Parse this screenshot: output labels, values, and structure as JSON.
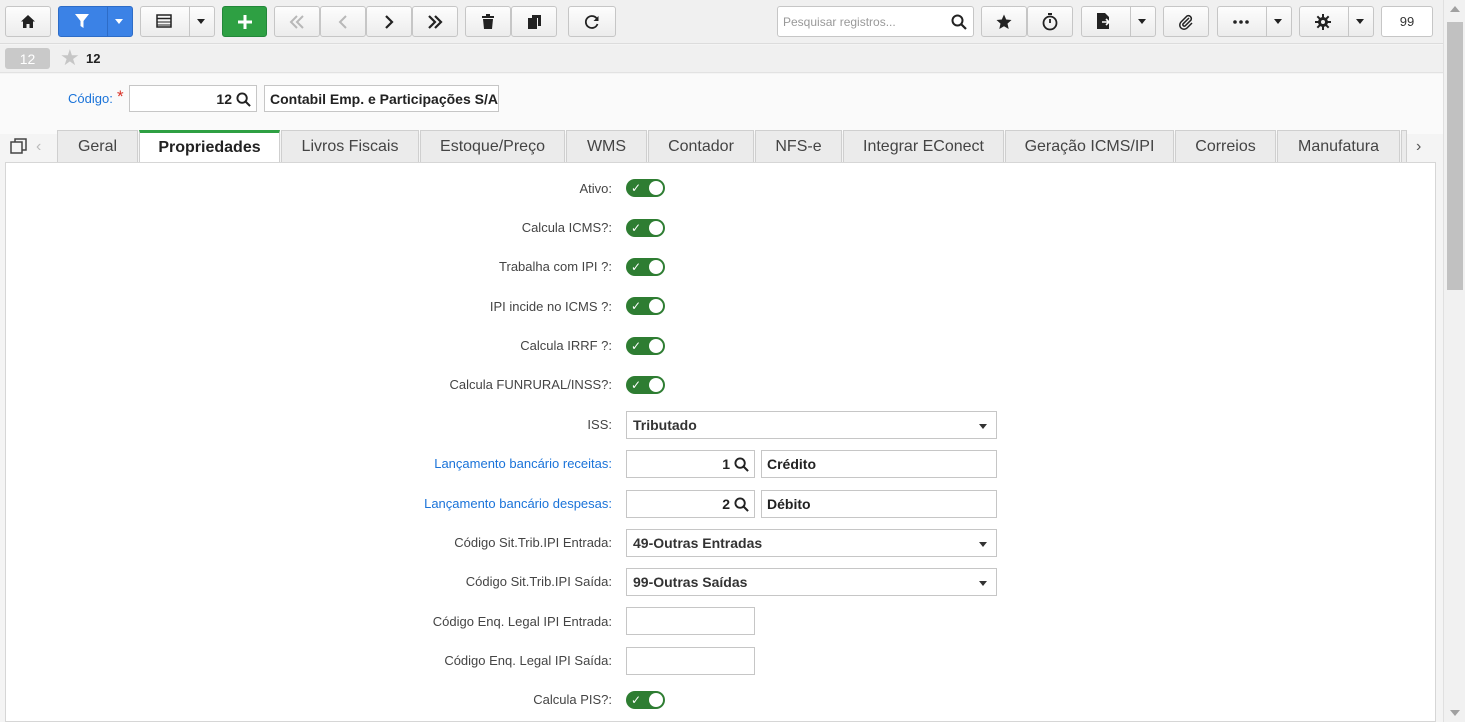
{
  "toolbar": {
    "search_placeholder": "Pesquisar registros...",
    "counter": "99",
    "icons": [
      "home-icon",
      "filter-icon",
      "table-icon",
      "add-icon",
      "first-icon",
      "prev-icon",
      "next-icon",
      "last-icon",
      "trash-icon",
      "copy-icon",
      "refresh-icon",
      "search-icon",
      "star-icon",
      "timer-icon",
      "export-icon",
      "attach-icon",
      "more-icon",
      "gear-icon"
    ],
    "colors": {
      "filter": "#3b82e6",
      "add": "#2ea043"
    }
  },
  "record": {
    "badge": "12",
    "number": "12"
  },
  "header": {
    "codigo_label": "Código:",
    "required_mark": "*",
    "codigo_value": "12",
    "name_value": "Contabil Emp. e Participações S/A"
  },
  "tabs": [
    {
      "label": "Geral",
      "active": false
    },
    {
      "label": "Propriedades",
      "active": true
    },
    {
      "label": "Livros Fiscais",
      "active": false
    },
    {
      "label": "Estoque/Preço",
      "active": false
    },
    {
      "label": "WMS",
      "active": false
    },
    {
      "label": "Contador",
      "active": false
    },
    {
      "label": "NFS-e",
      "active": false
    },
    {
      "label": "Integrar EConect",
      "active": false
    },
    {
      "label": "Geração ICMS/IPI",
      "active": false
    },
    {
      "label": "Correios",
      "active": false
    },
    {
      "label": "Manufatura",
      "active": false
    }
  ],
  "form": {
    "ativo": {
      "label": "Ativo:",
      "value": true
    },
    "calcula_icms": {
      "label": "Calcula ICMS?:",
      "value": true
    },
    "trabalha_ipi": {
      "label": "Trabalha com IPI ?:",
      "value": true
    },
    "ipi_incide": {
      "label": "IPI incide no ICMS ?:",
      "value": true
    },
    "calcula_irrf": {
      "label": "Calcula IRRF ?:",
      "value": true
    },
    "calcula_funrural": {
      "label": "Calcula FUNRURAL/INSS?:",
      "value": true
    },
    "iss": {
      "label": "ISS:",
      "value": "Tributado"
    },
    "lanc_receitas": {
      "label": "Lançamento bancário receitas:",
      "code": "1",
      "desc": "Crédito"
    },
    "lanc_despesas": {
      "label": "Lançamento bancário despesas:",
      "code": "2",
      "desc": "Débito"
    },
    "cst_ipi_entrada": {
      "label": "Código Sit.Trib.IPI Entrada:",
      "value": "49-Outras Entradas"
    },
    "cst_ipi_saida": {
      "label": "Código Sit.Trib.IPI Saída:",
      "value": "99-Outras Saídas"
    },
    "enq_entrada": {
      "label": "Código Enq. Legal IPI Entrada:",
      "value": ""
    },
    "enq_saida": {
      "label": "Código Enq. Legal IPI Saída:",
      "value": ""
    },
    "calcula_pis": {
      "label": "Calcula PIS?:",
      "value": true
    }
  }
}
